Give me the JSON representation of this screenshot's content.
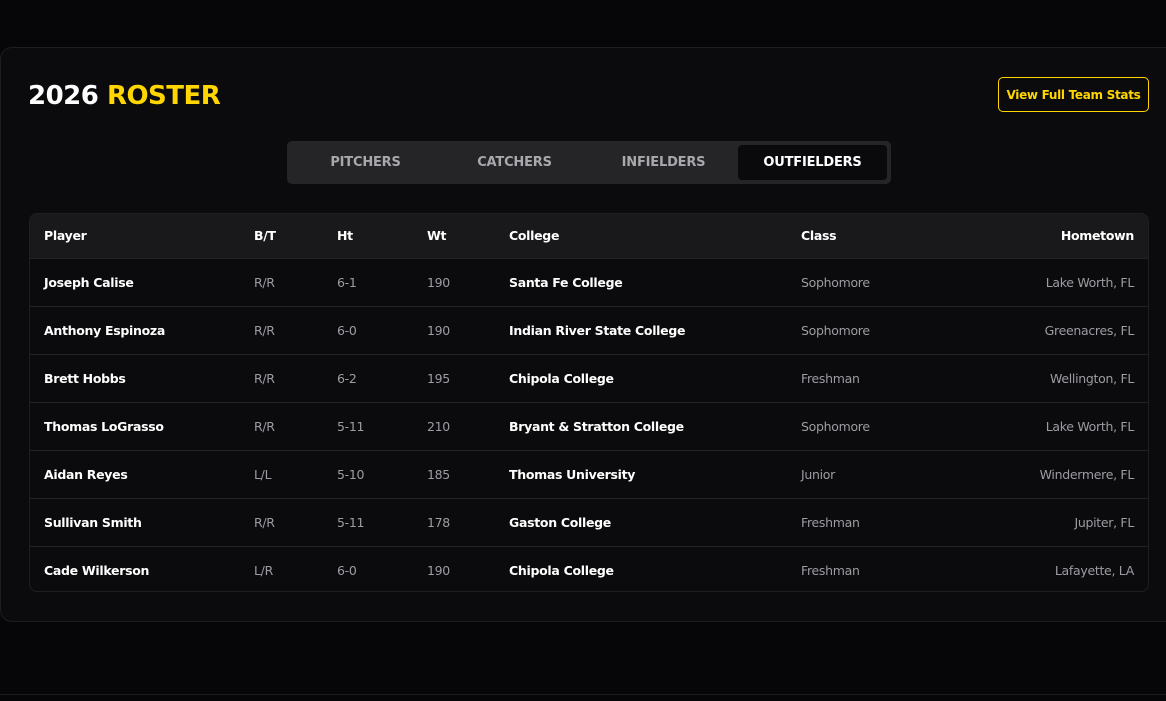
{
  "roster": {
    "title_year": "2026",
    "title_word": "ROSTER",
    "stats_button": "View Full Team Stats",
    "tabs": [
      {
        "label": "PITCHERS",
        "active": false
      },
      {
        "label": "CATCHERS",
        "active": false
      },
      {
        "label": "INFIELDERS",
        "active": false
      },
      {
        "label": "OUTFIELDERS",
        "active": true
      }
    ],
    "columns": {
      "player": "Player",
      "bt": "B/T",
      "ht": "Ht",
      "wt": "Wt",
      "college": "College",
      "class": "Class",
      "hometown": "Hometown"
    },
    "rows": [
      {
        "player": "Joseph Calise",
        "bt": "R/R",
        "ht": "6-1",
        "wt": "190",
        "college": "Santa Fe College",
        "class": "Sophomore",
        "hometown": "Lake Worth, FL"
      },
      {
        "player": "Anthony Espinoza",
        "bt": "R/R",
        "ht": "6-0",
        "wt": "190",
        "college": "Indian River State College",
        "class": "Sophomore",
        "hometown": "Greenacres, FL"
      },
      {
        "player": "Brett Hobbs",
        "bt": "R/R",
        "ht": "6-2",
        "wt": "195",
        "college": "Chipola College",
        "class": "Freshman",
        "hometown": "Wellington, FL"
      },
      {
        "player": "Thomas LoGrasso",
        "bt": "R/R",
        "ht": "5-11",
        "wt": "210",
        "college": "Bryant & Stratton College",
        "class": "Sophomore",
        "hometown": "Lake Worth, FL"
      },
      {
        "player": "Aidan Reyes",
        "bt": "L/L",
        "ht": "5-10",
        "wt": "185",
        "college": "Thomas University",
        "class": "Junior",
        "hometown": "Windermere, FL"
      },
      {
        "player": "Sullivan Smith",
        "bt": "R/R",
        "ht": "5-11",
        "wt": "178",
        "college": "Gaston College",
        "class": "Freshman",
        "hometown": "Jupiter, FL"
      },
      {
        "player": "Cade Wilkerson",
        "bt": "L/R",
        "ht": "6-0",
        "wt": "190",
        "college": "Chipola College",
        "class": "Freshman",
        "hometown": "Lafayette, LA"
      }
    ]
  },
  "colors": {
    "accent": "#ffd600",
    "background": "#0b0b0d",
    "text": "#ffffff",
    "muted_text": "#9c9ca2"
  }
}
